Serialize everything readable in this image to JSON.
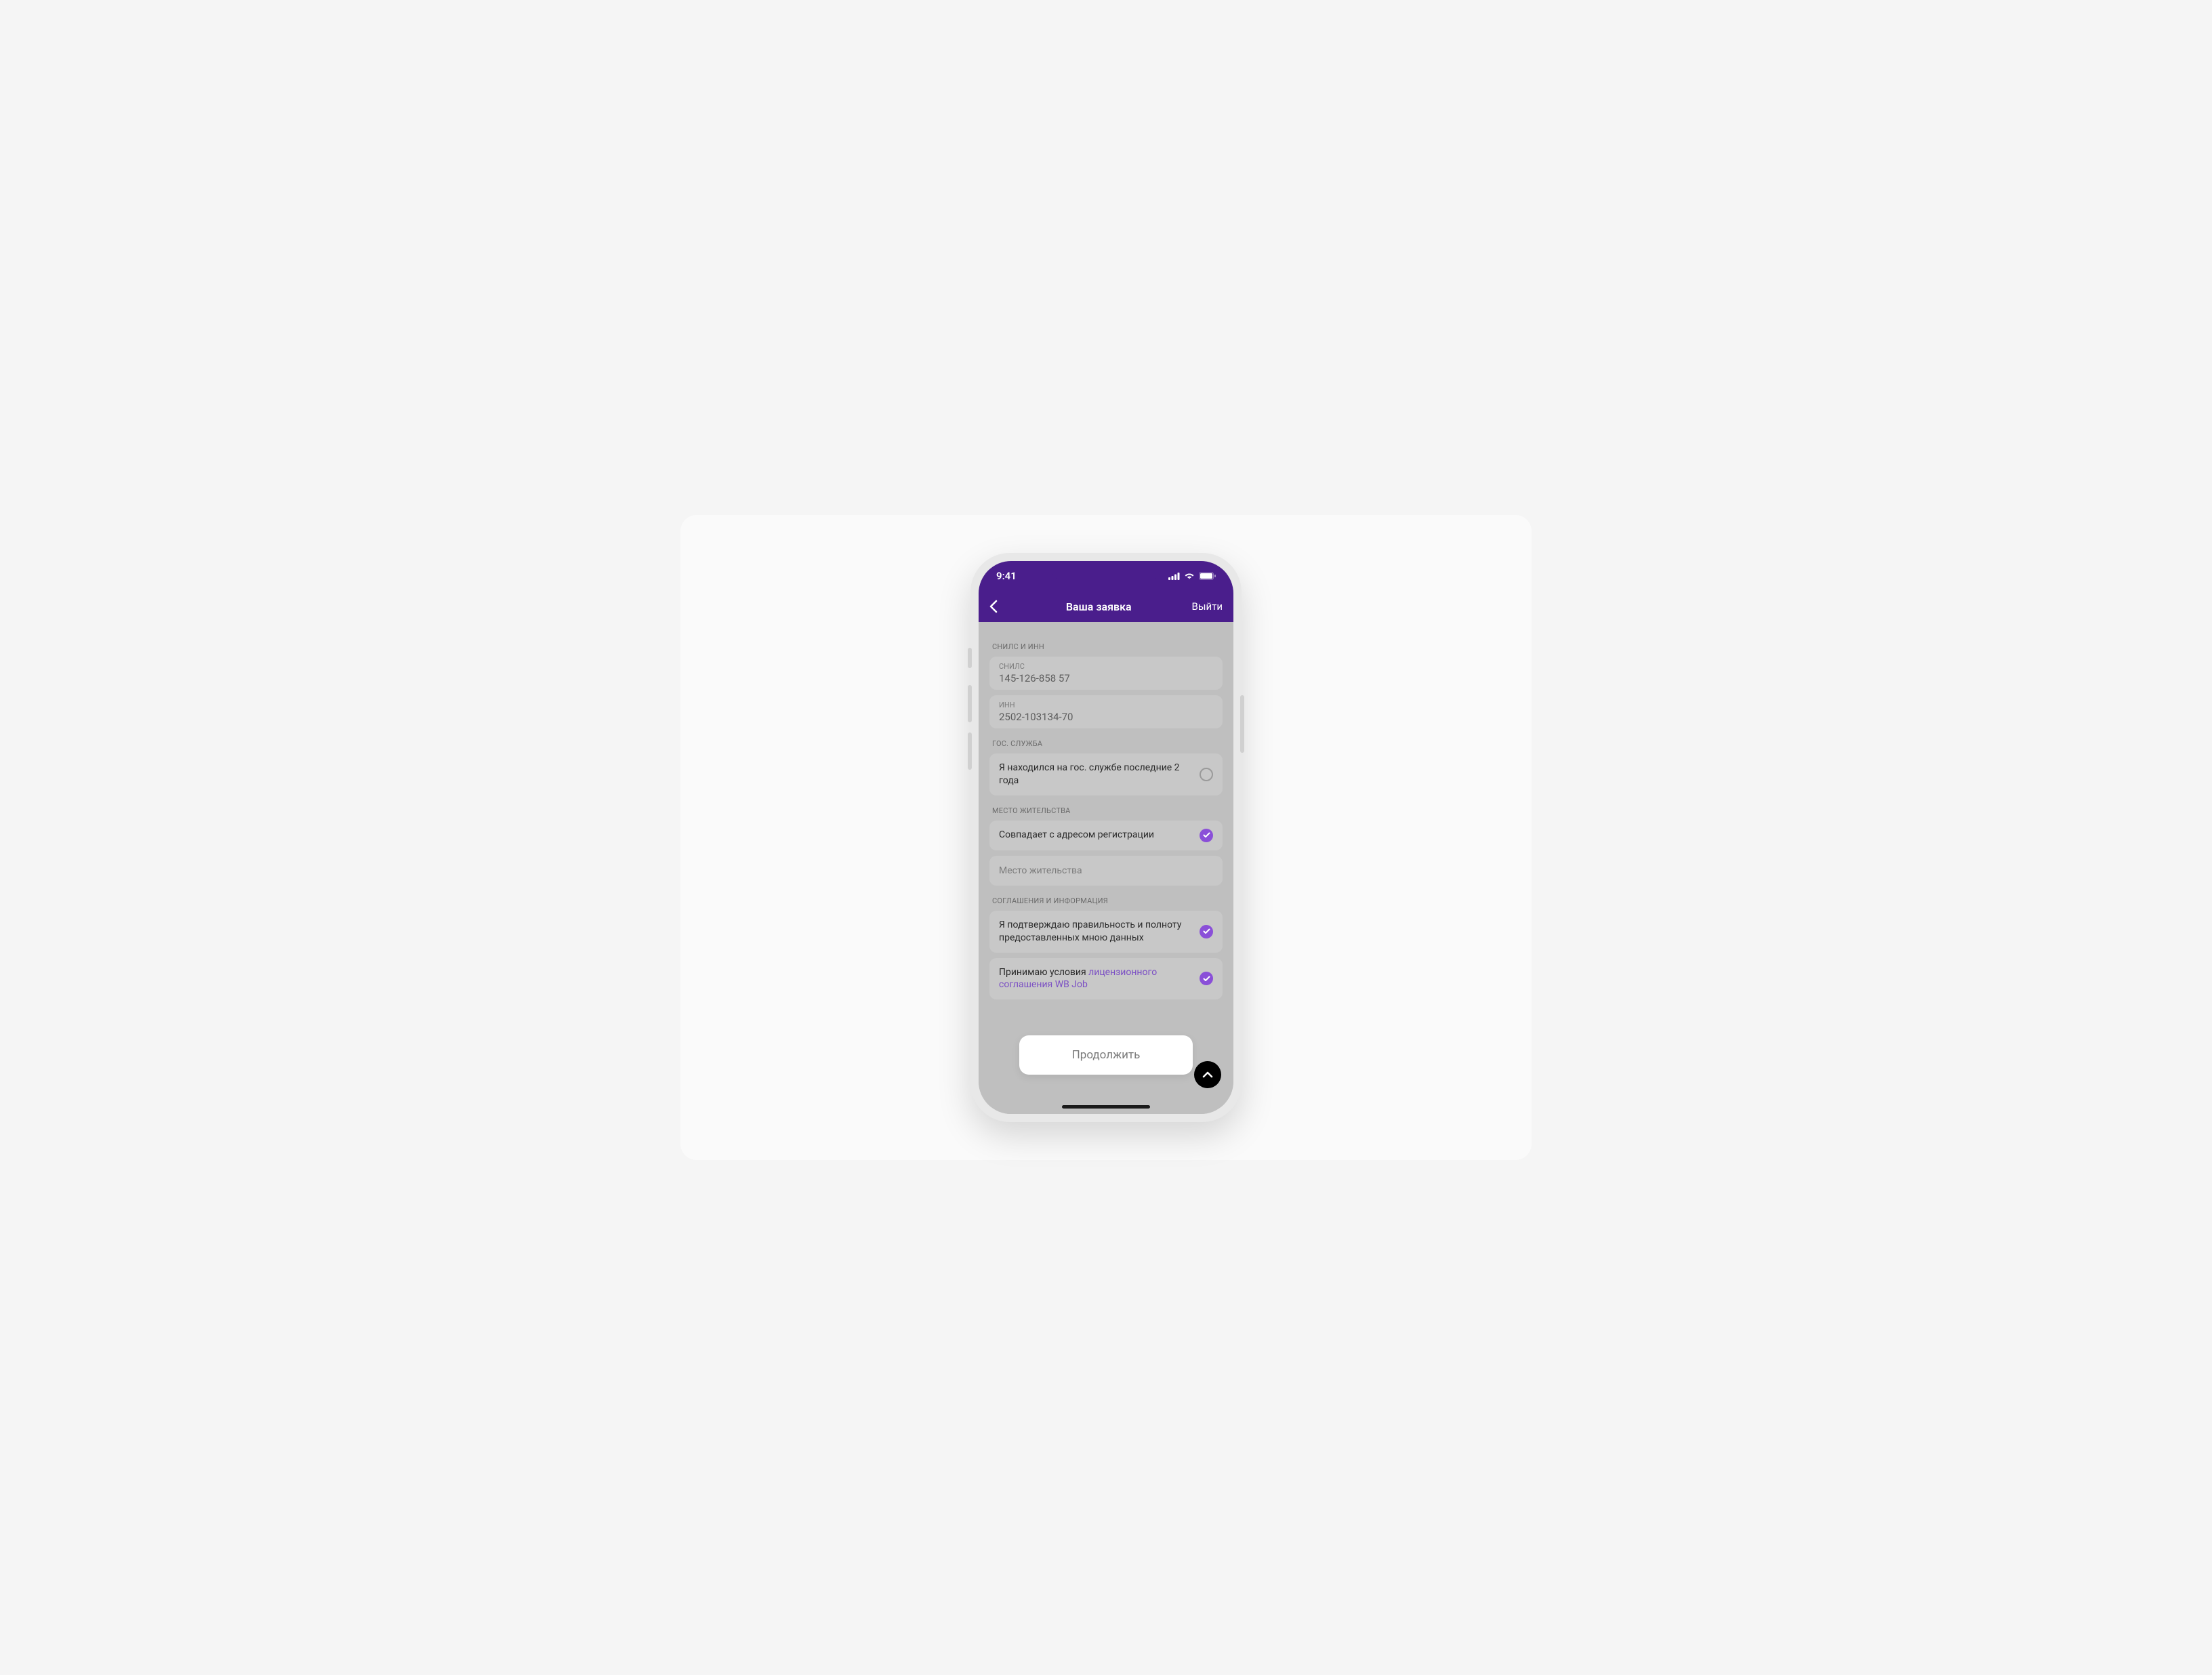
{
  "status": {
    "time": "9:41"
  },
  "nav": {
    "title": "Ваша заявка",
    "exit": "Выйти"
  },
  "sections": {
    "snils_inn": {
      "header": "СНИЛС И ИНН",
      "snils_label": "СНИЛС",
      "snils_value": "145-126-858 57",
      "inn_label": "ИНН",
      "inn_value": "2502-103134-70"
    },
    "gov": {
      "header": "ГОС. СЛУЖБА",
      "text": "Я находился на гос. службе последние 2 года"
    },
    "residence": {
      "header": "МЕСТО ЖИТЕЛЬСТВА",
      "same_text": "Совпадает с адресом регистрации",
      "placeholder": "Место жительства"
    },
    "agreements": {
      "header": "СОГЛАШЕНИЯ И ИНФОРМАЦИЯ",
      "confirm_text": "Я подтверждаю правильность и полноту предоставленных мною данных",
      "license_prefix": "Принимаю условия ",
      "license_link": "лицензионного соглашения WB Job"
    }
  },
  "cta": {
    "continue": "Продолжить"
  }
}
